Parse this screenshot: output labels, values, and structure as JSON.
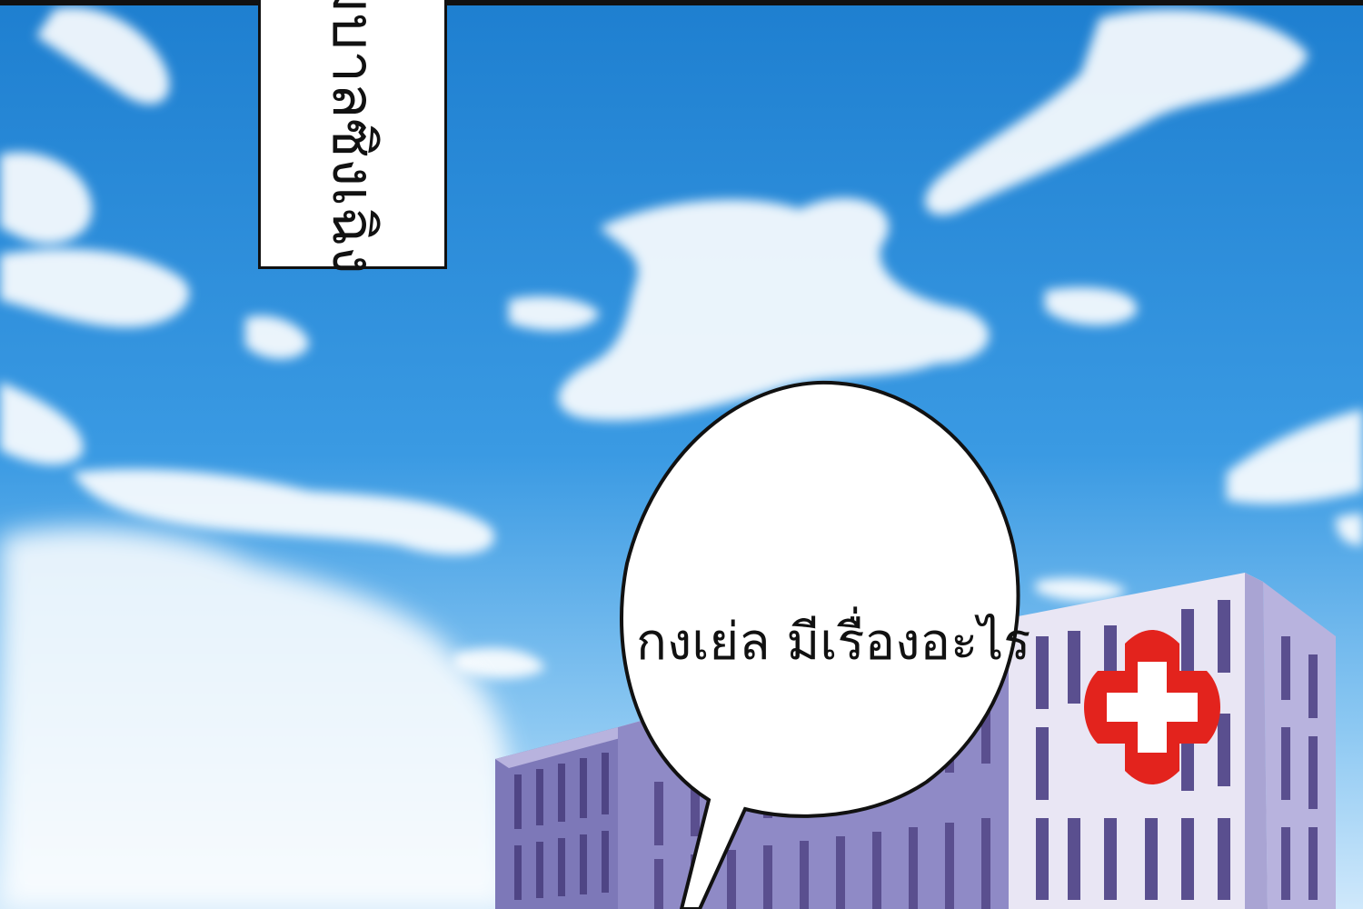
{
  "caption": {
    "text": "มบาลซิงเฉิง"
  },
  "speech_bubble": {
    "text": "กงเย่ล มีเรื่องอะไร"
  },
  "colors": {
    "sky_top": "#1e7fd0",
    "sky_mid": "#3a9ae3",
    "sky_bottom": "#cfe8fb",
    "cloud": "#ffffff",
    "building_facade": "#e9e6f4",
    "building_shadow": "#7d78b8",
    "window": "#5a4f8f",
    "cross_red": "#e3231d",
    "outline": "#111111"
  },
  "icons": {
    "hospital_sign": "red-cross-icon"
  }
}
